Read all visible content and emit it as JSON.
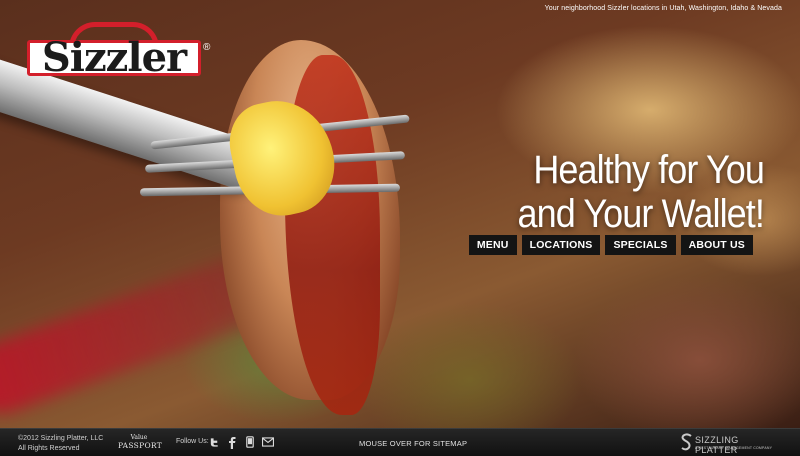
{
  "header": {
    "tagline": "Your neighborhood Sizzler locations in Utah, Washington, Idaho & Nevada"
  },
  "logo": {
    "text": "Sizzler",
    "registered": "®"
  },
  "hero": {
    "headline_line1": "Healthy for You",
    "headline_line2": "and Your Wallet!"
  },
  "nav": {
    "items": [
      {
        "label": "MENU"
      },
      {
        "label": "LOCATIONS"
      },
      {
        "label": "SPECIALS"
      },
      {
        "label": "ABOUT US"
      }
    ]
  },
  "footer": {
    "copyright_line1": "©2012 Sizzling Platter, LLC",
    "copyright_line2": "All Rights Reserved",
    "value_passport_top": "Value",
    "value_passport_bottom": "PASSPORT",
    "follow_label": "Follow Us:",
    "social_icons": [
      "twitter-icon",
      "facebook-icon",
      "mobile-icon",
      "email-icon"
    ],
    "sitemap_label": "MOUSE OVER FOR SITEMAP",
    "brand_name": "SIZZLING PLATTER",
    "brand_sub": "A RESTAURANT MANAGEMENT COMPANY"
  },
  "colors": {
    "brand_red": "#d31f2b",
    "nav_bg": "#141414",
    "footer_bg": "#1a1a1a"
  }
}
